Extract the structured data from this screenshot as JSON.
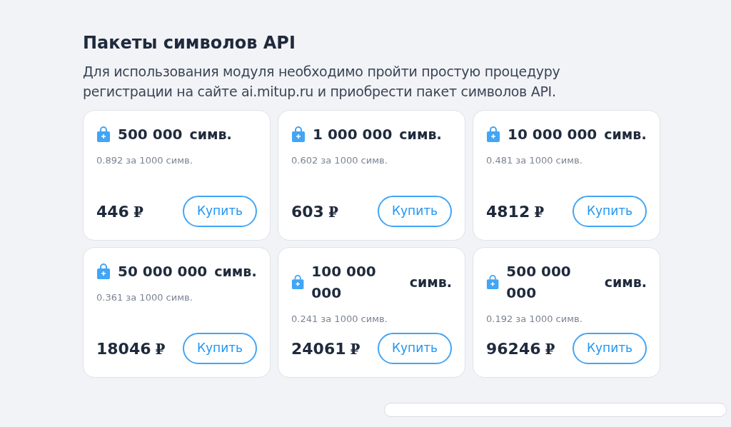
{
  "title": "Пакеты символов API",
  "description": "Для использования модуля необходимо пройти простую процедуру регистрации на сайте ai.mitup.ru и приобрести пакет символов API.",
  "packages": [
    {
      "amount": "500 000",
      "unit": "симв.",
      "rate": "0.892 за 1000 симв.",
      "price": "446",
      "currency": "₽",
      "button": "Купить"
    },
    {
      "amount": "1 000 000",
      "unit": "симв.",
      "rate": "0.602 за 1000 симв.",
      "price": "603",
      "currency": "₽",
      "button": "Купить"
    },
    {
      "amount": "10 000 000",
      "unit": "симв.",
      "rate": "0.481 за 1000 симв.",
      "price": "4812",
      "currency": "₽",
      "button": "Купить"
    },
    {
      "amount": "50 000 000",
      "unit": "симв.",
      "rate": "0.361 за 1000 симв.",
      "price": "18046",
      "currency": "₽",
      "button": "Купить"
    },
    {
      "amount": "100 000 000",
      "unit": "симв.",
      "rate": "0.241 за 1000 симв.",
      "price": "24061",
      "currency": "₽",
      "button": "Купить"
    },
    {
      "amount": "500 000 000",
      "unit": "симв.",
      "rate": "0.192 за 1000 симв.",
      "price": "96246",
      "currency": "₽",
      "button": "Купить"
    }
  ]
}
